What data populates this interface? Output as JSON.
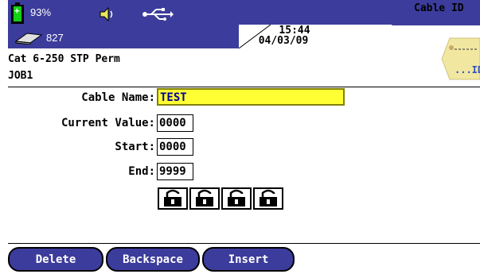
{
  "status": {
    "battery_percent": "93%",
    "disk_count": "827",
    "time": "15:44",
    "date": "04/03/09",
    "app_title": "Cable ID"
  },
  "job": {
    "cable_type": "Cat 6-250 STP Perm",
    "job_name": "JOB1"
  },
  "form": {
    "cable_name_label": "Cable Name:",
    "cable_name_value": "TEST",
    "current_value_label": "Current Value:",
    "current_value": "0000",
    "start_label": "Start:",
    "start_value": "0000",
    "end_label": "End:",
    "end_value": "9999"
  },
  "buttons": {
    "delete": "Delete",
    "backspace": "Backspace",
    "insert": "Insert"
  },
  "colors": {
    "status_bar": "#3c3c9c",
    "active_field": "#ffff33",
    "button": "#3c3c9c"
  }
}
